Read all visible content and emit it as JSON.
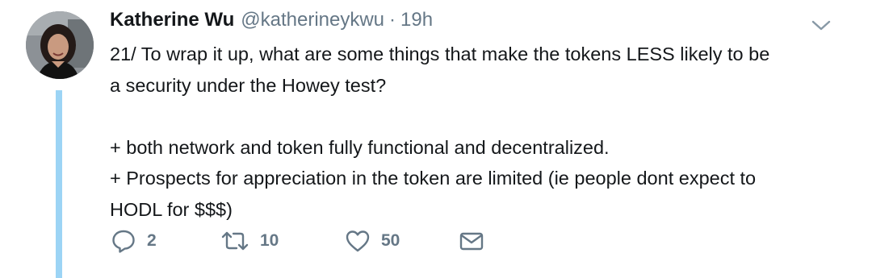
{
  "tweet": {
    "author_name": "Katherine Wu",
    "author_handle": "@katherineykwu",
    "separator": "·",
    "timestamp": "19h",
    "lines": [
      "21/ To wrap it up, what are some things that make the tokens LESS likely to be",
      "a security under the Howey test?",
      "",
      "+ both network and token fully functional and decentralized.",
      "+ Prospects for appreciation in the token are limited (ie people dont expect to",
      "HODL for $$$)"
    ],
    "actions": {
      "reply_icon": "reply-icon",
      "reply_count": "2",
      "retweet_icon": "retweet-icon",
      "retweet_count": "10",
      "like_icon": "heart-icon",
      "like_count": "50",
      "dm_icon": "envelope-icon"
    },
    "menu_icon": "chevron-down-icon"
  },
  "colors": {
    "text": "#14171a",
    "secondary": "#657786",
    "thread_line": "#9cd4f5",
    "background": "#ffffff"
  }
}
